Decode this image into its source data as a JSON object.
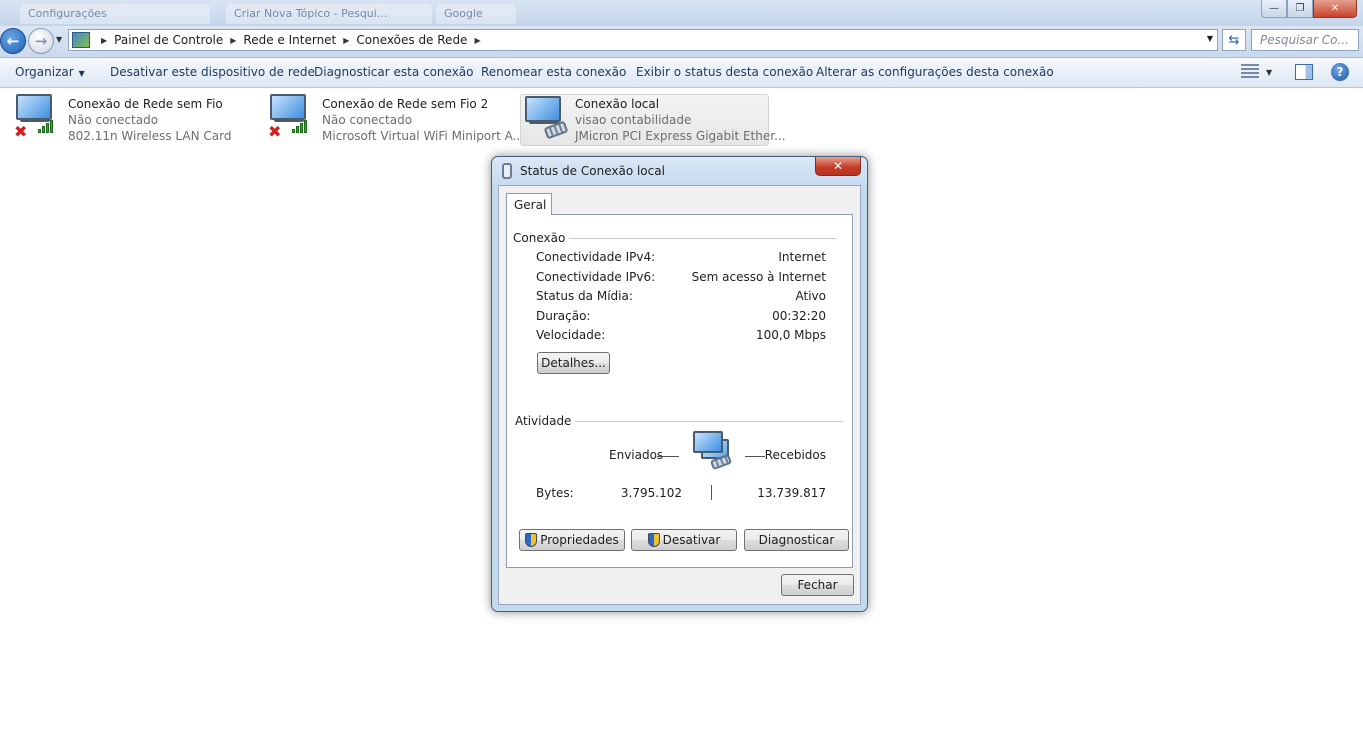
{
  "titlebar": {
    "faded_tabs": [
      "Configurações",
      "Criar Nova Tópico - Pesqui...",
      "Google"
    ],
    "minimize": "—",
    "maximize": "❐",
    "close": "✕"
  },
  "address": {
    "breadcrumbs": [
      "Painel de Controle",
      "Rede e Internet",
      "Conexões de Rede"
    ],
    "search_placeholder": "Pesquisar Co..."
  },
  "commands": {
    "organize": "Organizar",
    "items": [
      "Desativar este dispositivo de rede",
      "Diagnosticar esta conexão",
      "Renomear esta conexão",
      "Exibir o status desta conexão",
      "Alterar as configurações desta conexão"
    ]
  },
  "connections": [
    {
      "name": "Conexão de Rede sem Fio",
      "status": "Não conectado",
      "device": "802.11n Wireless LAN Card"
    },
    {
      "name": "Conexão de Rede sem Fio 2",
      "status": "Não conectado",
      "device": "Microsoft Virtual WiFi Miniport A..."
    },
    {
      "name": "Conexão local",
      "status": "visao contabilidade",
      "device": "JMicron PCI Express Gigabit Ether..."
    }
  ],
  "dialog": {
    "title": "Status de Conexão local",
    "close": "✕",
    "tab": "Geral",
    "connection_group": "Conexão",
    "rows": [
      {
        "label": "Conectividade IPv4:",
        "value": "Internet"
      },
      {
        "label": "Conectividade IPv6:",
        "value": "Sem acesso à Internet"
      },
      {
        "label": "Status da Mídia:",
        "value": "Ativo"
      },
      {
        "label": "Duração:",
        "value": "00:32:20"
      },
      {
        "label": "Velocidade:",
        "value": "100,0 Mbps"
      }
    ],
    "details_button": "Detalhes...",
    "activity_group": "Atividade",
    "sent_label": "Enviados",
    "received_label": "Recebidos",
    "bytes_label": "Bytes:",
    "bytes_sent": "3.795.102",
    "bytes_received": "13.739.817",
    "properties_button": "Propriedades",
    "disable_button": "Desativar",
    "diagnose_button": "Diagnosticar",
    "close_button": "Fechar"
  }
}
